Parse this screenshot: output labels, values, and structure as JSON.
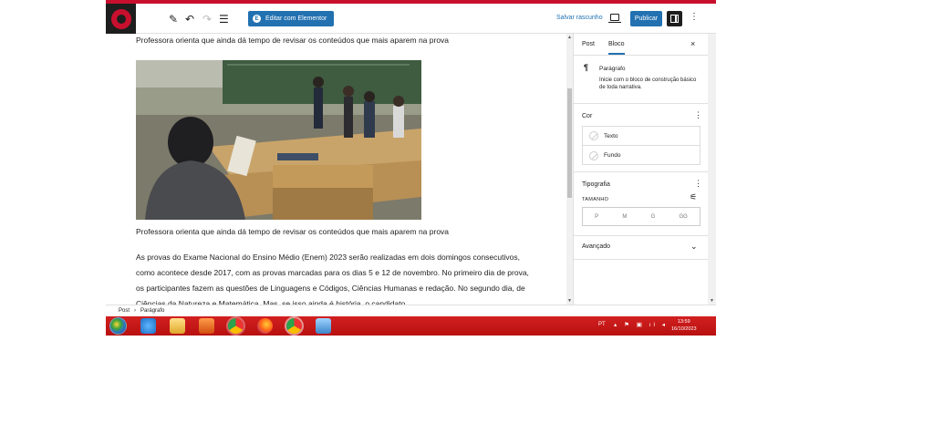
{
  "toolbar": {
    "add_label": "+",
    "edit_label": "Editar com Elementor",
    "save_draft": "Salvar rascunho",
    "publish": "Publicar"
  },
  "content": {
    "caption_top": "Professora orienta que ainda dá tempo de revisar os conteúdos que mais aparem na prova",
    "caption_bottom": "Professora orienta que ainda dá tempo de revisar os conteúdos que mais aparem na prova",
    "paragraph": "As provas do Exame Nacional do Ensino Médio (Enem) 2023 serão realizadas em dois domingos consecutivos, como acontece desde 2017, com as provas marcadas para os dias 5 e 12 de novembro. No primeiro dia de prova, os participantes fazem as questões de Linguagens e Códigos, Ciências Humanas e redação. No segundo dia, de Ciências da Natureza e Matemática. Mas, se isso ainda é história, o candidato"
  },
  "sidebar": {
    "tab_post": "Post",
    "tab_block": "Bloco",
    "close": "×",
    "block_title": "Parágrafo",
    "block_desc": "Inicie com o bloco de construção básico de toda narrativa.",
    "color_title": "Cor",
    "color_text": "Texto",
    "color_background": "Fundo",
    "typography_title": "Tipografia",
    "size_label": "TAMANHO",
    "sizes": [
      "P",
      "M",
      "G",
      "GG"
    ],
    "advanced_title": "Avançado"
  },
  "breadcrumb": {
    "root": "Post",
    "separator": "›",
    "current": "Parágrafo"
  },
  "taskbar": {
    "language": "PT",
    "time": "13:59",
    "date": "16/10/2023"
  },
  "colors": {
    "accent": "#2271b1",
    "taskbar": "#c8102e",
    "dark": "#1e1e1e"
  }
}
